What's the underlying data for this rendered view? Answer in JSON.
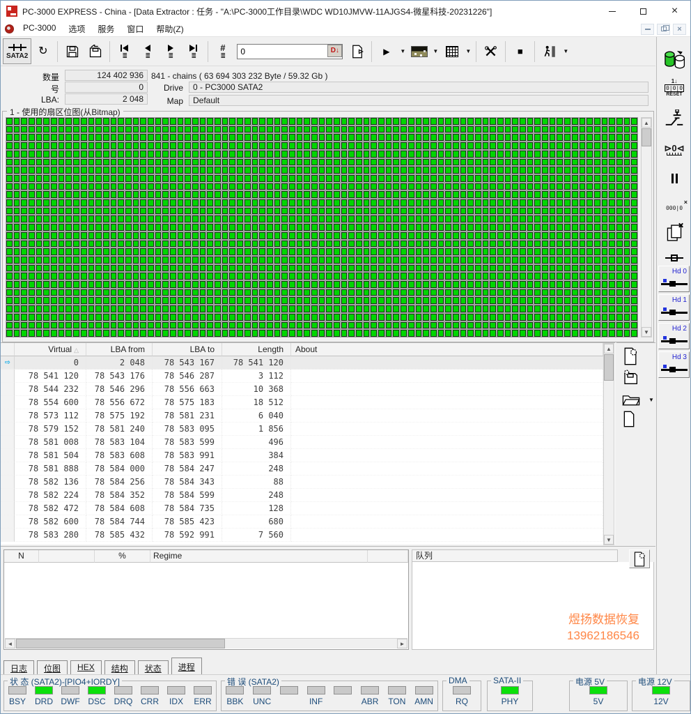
{
  "window": {
    "title": "PC-3000 EXPRESS - China - [Data Extractor : 任务 - \"A:\\PC-3000工作目录\\WDC WD10JMVW-11AJGS4-微星科技-20231226\"]"
  },
  "menu": {
    "items": [
      "PC-3000",
      "选项",
      "服务",
      "窗口",
      "帮助(Z)"
    ]
  },
  "toolbar": {
    "sata2": "SATA2",
    "sector_value": "0",
    "d_button": "D"
  },
  "info": {
    "qty_label": "数量",
    "qty_value": "124 402 936",
    "chains_text": "841 - chains  ( 63 694 303 232 Byte /  59.32 Gb )",
    "num_label": "号",
    "num_value": "0",
    "drive_label": "Drive",
    "drive_value": "0 - PC3000 SATA2",
    "lba_label": "LBA:",
    "lba_value": "2 048",
    "map_label": "Map",
    "map_value": "Default"
  },
  "bitmap": {
    "group_title": "1 - 使用的扇区位图(从Bitmap)",
    "rows": 27,
    "cols": 85,
    "all_used": true
  },
  "chain_table": {
    "columns": [
      "Virtual",
      "LBA from",
      "LBA to",
      "Length",
      "About"
    ],
    "selected_row": 0,
    "rows": [
      [
        "0",
        "2 048",
        "78 543 167",
        "78 541 120",
        ""
      ],
      [
        "78 541 120",
        "78 543 176",
        "78 546 287",
        "3 112",
        ""
      ],
      [
        "78 544 232",
        "78 546 296",
        "78 556 663",
        "10 368",
        ""
      ],
      [
        "78 554 600",
        "78 556 672",
        "78 575 183",
        "18 512",
        ""
      ],
      [
        "78 573 112",
        "78 575 192",
        "78 581 231",
        "6 040",
        ""
      ],
      [
        "78 579 152",
        "78 581 240",
        "78 583 095",
        "1 856",
        ""
      ],
      [
        "78 581 008",
        "78 583 104",
        "78 583 599",
        "496",
        ""
      ],
      [
        "78 581 504",
        "78 583 608",
        "78 583 991",
        "384",
        ""
      ],
      [
        "78 581 888",
        "78 584 000",
        "78 584 247",
        "248",
        ""
      ],
      [
        "78 582 136",
        "78 584 256",
        "78 584 343",
        "88",
        ""
      ],
      [
        "78 582 224",
        "78 584 352",
        "78 584 599",
        "248",
        ""
      ],
      [
        "78 582 472",
        "78 584 608",
        "78 584 735",
        "128",
        ""
      ],
      [
        "78 582 600",
        "78 584 744",
        "78 585 423",
        "680",
        ""
      ],
      [
        "78 583 280",
        "78 585 432",
        "78 592 991",
        "7 560",
        ""
      ]
    ]
  },
  "bottom": {
    "left_columns": [
      "N",
      "",
      "%",
      "Regime",
      ""
    ],
    "queue_title": "队列",
    "watermark_line1": "煜扬数据恢复",
    "watermark_line2": "13962186546"
  },
  "tabs": {
    "items": [
      "日志",
      "位图",
      "HEX",
      "结构",
      "状态",
      "进程"
    ],
    "active": "进程"
  },
  "status": {
    "groups": [
      {
        "title": "状 态 (SATA2)-[PIO4+IORDY]",
        "leds": [
          {
            "label": "BSY",
            "on": false
          },
          {
            "label": "DRD",
            "on": true
          },
          {
            "label": "DWF",
            "on": false
          },
          {
            "label": "DSC",
            "on": true
          },
          {
            "label": "DRQ",
            "on": false
          },
          {
            "label": "CRR",
            "on": false
          },
          {
            "label": "IDX",
            "on": false
          },
          {
            "label": "ERR",
            "on": false
          }
        ]
      },
      {
        "title": "错 误 (SATA2)",
        "leds": [
          {
            "label": "BBK",
            "on": false
          },
          {
            "label": "UNC",
            "on": false
          },
          {
            "label": "",
            "on": false
          },
          {
            "label": "INF",
            "on": false
          },
          {
            "label": "",
            "on": false
          },
          {
            "label": "ABR",
            "on": false
          },
          {
            "label": "TON",
            "on": false
          },
          {
            "label": "AMN",
            "on": false
          }
        ]
      },
      {
        "title": "DMA",
        "leds": [
          {
            "label": "RQ",
            "on": false
          }
        ]
      },
      {
        "title": "SATA-II",
        "leds": [
          {
            "label": "PHY",
            "on": true
          }
        ]
      },
      {
        "title": "电源 5V",
        "leds": [
          {
            "label": "5V",
            "on": true
          }
        ]
      },
      {
        "title": "电源 12V",
        "leds": [
          {
            "label": "12V",
            "on": true
          }
        ]
      }
    ]
  },
  "sidebar": {
    "hd_buttons": [
      "Hd 0",
      "Hd 1",
      "Hd 2",
      "Hd 3"
    ],
    "reset_top": "1↓",
    "reset_box": "0|0|0",
    "reset_label": "RESET",
    "counter_glyph": "⊳0⊲",
    "skip_pattern": "000|0",
    "skip_x": "×"
  },
  "icons": {
    "close": "×",
    "mdi_close": "×",
    "dropdown": "▼",
    "play": "▶",
    "stop": "■",
    "hash": "#",
    "refresh": "↻",
    "sort_asc": "△",
    "row_cursor": "⇨",
    "up": "▲",
    "down": "▼",
    "left": "◄",
    "right": "►",
    "stack": "≣",
    "d_arrow": "↓"
  },
  "colors": {
    "led_on": "#0be00b",
    "led_off": "#c9c9c9",
    "bitmap_cell": "#00d600",
    "watermark": "#ff8747",
    "status_label": "#1c4b79",
    "hd_label": "#1f1fd0",
    "d_button_red": "#c11414",
    "selection_arrow": "#00a6e8"
  }
}
